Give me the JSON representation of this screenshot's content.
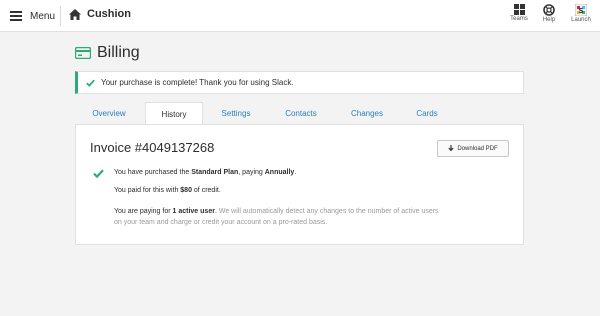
{
  "topbar": {
    "menu_label": "Menu",
    "team_name": "Cushion",
    "icons": [
      {
        "name": "teams-icon",
        "label": "Teams"
      },
      {
        "name": "help-icon",
        "label": "Help"
      },
      {
        "name": "launch-icon",
        "label": "Launch"
      }
    ]
  },
  "billing": {
    "title": "Billing",
    "alert": "Your purchase is complete! Thank you for using Slack."
  },
  "tabs": [
    {
      "label": "Overview",
      "active": false
    },
    {
      "label": "History",
      "active": true
    },
    {
      "label": "Settings",
      "active": false
    },
    {
      "label": "Contacts",
      "active": false
    },
    {
      "label": "Changes",
      "active": false
    },
    {
      "label": "Cards",
      "active": false
    }
  ],
  "invoice": {
    "title": "Invoice #4049137268",
    "download_label": "Download PDF",
    "line1": {
      "pre": "You have purchased the ",
      "plan": "Standard Plan",
      "mid": ", paying ",
      "period": "Annually",
      "post": "."
    },
    "line2": {
      "pre": "You paid for this with ",
      "amount": "$80",
      "post": " of credit."
    },
    "line3": {
      "pre": "You are paying for ",
      "count": "1 active user",
      "post": ".",
      "muted1": " We will automatically detect any changes to the number of active users",
      "muted2": "on your team and charge or credit your account on a pro-rated basis."
    }
  },
  "colors": {
    "accent_green": "#2bac76",
    "link_blue": "#2a80b9",
    "billing_icon": "#2bac76"
  }
}
